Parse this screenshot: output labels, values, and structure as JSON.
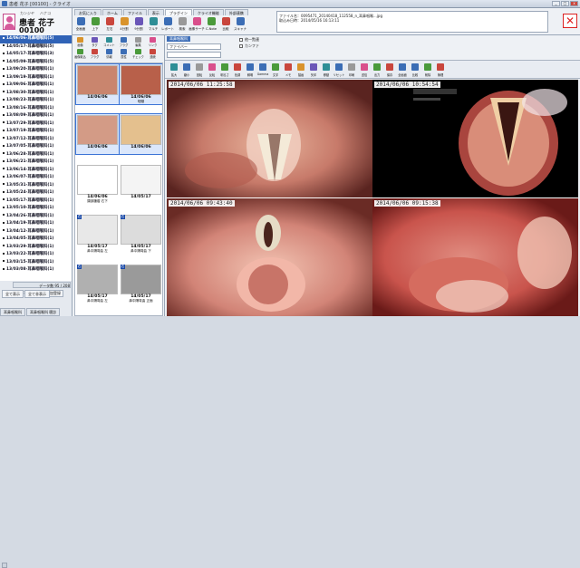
{
  "window": {
    "title": "患者 花子 [00100] - クライオ"
  },
  "patient": {
    "kana_last": "カンジヤ",
    "kana_first": "ハナコ",
    "name": "患者 花子",
    "id": "00100"
  },
  "ribbon": {
    "tabs": [
      "お気に入り",
      "ホーム",
      "ファイル",
      "表示",
      "プラグイン",
      "クライオ機能",
      "外部連携"
    ],
    "buttons": [
      "全画面",
      "上下",
      "左右",
      "4分割",
      "9分割",
      "マルチ",
      "レポート",
      "検索",
      "画像サーチ",
      "C-Note",
      "比較",
      "スキャナ"
    ],
    "filename": "ファイル名：0095471_20140418_112558_n_耳鼻咽喉...jpg",
    "import_date": "取込み日時：2014/05/16 16:13:11",
    "size": "サイズ：1280 x 720 / コメント",
    "close": "✕"
  },
  "datelist": {
    "items": [
      "14/06/06-耳鼻咽喉科(5)",
      "14/05/17-耳鼻咽喉科(5)",
      "14/05/17-耳鼻咽喉科(3)",
      "14/05/09-耳鼻咽喉科(5)",
      "13/09/20-耳鼻咽喉科(1)",
      "13/09/19-耳鼻咽喉科(1)",
      "13/09/06-耳鼻咽喉科(1)",
      "13/08/30-耳鼻咽喉科(1)",
      "13/08/23-耳鼻咽喉科(1)",
      "13/08/16-耳鼻咽喉科(1)",
      "13/08/09-耳鼻咽喉科(1)",
      "13/07/29-耳鼻咽喉科(1)",
      "13/07/19-耳鼻咽喉科(1)",
      "13/07/12-耳鼻咽喉科(1)",
      "13/07/05-耳鼻咽喉科(1)",
      "13/06/28-耳鼻咽喉科(1)",
      "13/06/21-耳鼻咽喉科(1)",
      "13/06/14-耳鼻咽喉科(1)",
      "13/06/07-耳鼻咽喉科(1)",
      "13/05/31-耳鼻咽喉科(1)",
      "13/05/24-耳鼻咽喉科(1)",
      "13/05/17-耳鼻咽喉科(1)",
      "13/05/10-耳鼻咽喉科(1)",
      "13/04/26-耳鼻咽喉科(1)",
      "13/04/19-耳鼻咽喉科(1)",
      "13/04/12-耳鼻咽喉科(1)",
      "13/04/05-耳鼻咽喉科(1)",
      "13/03/29-耳鼻咽喉科(1)",
      "13/03/22-耳鼻咽喉科(1)",
      "13/03/15-耳鼻咽喉科(1)",
      "13/03/08-耳鼻咽喉科(1)"
    ],
    "count": "データ数 95 / 208",
    "conf_label": "カンファレンス",
    "conf_btns": [
      "全て表示",
      "全て非表示"
    ],
    "reg_btn": "患者追加登録",
    "bottom_tabs": [
      "耳鼻咽喉科",
      "耳鼻咽喉科 聴診"
    ]
  },
  "middle": {
    "icons": [
      "画像",
      "タグ",
      "コメント",
      "フラグ",
      "編集",
      "リンク",
      "画像取込",
      "フラグ",
      "情報",
      "属性",
      "チェック",
      "連続"
    ],
    "thumbs": [
      {
        "date": "14/06/06",
        "label": ""
      },
      {
        "date": "14/06/06",
        "label": "咽頭"
      },
      {
        "date": "14/06/06",
        "label": ""
      },
      {
        "date": "14/06/06",
        "label": ""
      },
      {
        "date": "14/06/06",
        "label": "頸部腫瘤 右下"
      },
      {
        "date": "14/05/17",
        "label": ""
      },
      {
        "date": "14/05/17",
        "label": "鼻中隔弯曲 左"
      },
      {
        "date": "14/05/17",
        "label": "鼻中隔弯曲 下"
      },
      {
        "date": "14/05/17",
        "label": "鼻中隔弯曲 左"
      },
      {
        "date": "14/05/17",
        "label": "鼻中隔弯曲 正面"
      }
    ]
  },
  "viewer": {
    "combo1_label": "耳鼻咽喉科",
    "combo2_value": "ファイバー",
    "checks": [
      "他一覧連",
      "カンファ"
    ],
    "tools": [
      "拡大",
      "縮小",
      "回転",
      "反転",
      "明るさ",
      "色調",
      "鮮明",
      "Gamma",
      "文字",
      "メモ",
      "描画",
      "矢印",
      "移動",
      "リセット",
      "印刷",
      "送信",
      "出力",
      "保存",
      "全画面",
      "比較",
      "削除",
      "管理"
    ],
    "timestamps": [
      "2014/06/06 11:25:58",
      "2014/06/06 10:54:54",
      "2014/06/06 09:43:40",
      "2014/06/06 09:15:38"
    ]
  },
  "colors": {
    "accent": "#3063b7",
    "close": "#d22222",
    "avatar": "#d65a9c"
  }
}
